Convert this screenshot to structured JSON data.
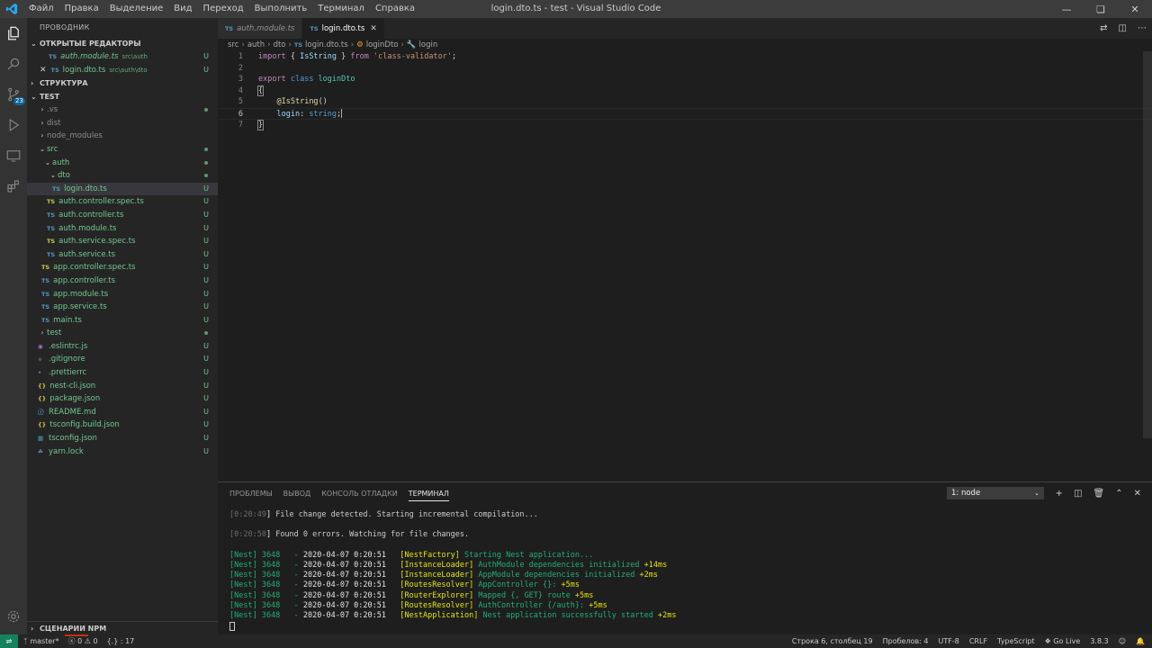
{
  "titlebar": {
    "menu": [
      "Файл",
      "Правка",
      "Выделение",
      "Вид",
      "Переход",
      "Выполнить",
      "Терминал",
      "Справка"
    ],
    "title": "login.dto.ts - test - Visual Studio Code"
  },
  "activity_bar": {
    "scm_badge": "23"
  },
  "sidebar": {
    "title": "ПРОВОДНИК",
    "open_editors_label": "ОТКРЫТЫЕ РЕДАКТОРЫ",
    "open_editors": [
      {
        "name": "auth.module.ts",
        "path": "src\\auth",
        "status": "U"
      },
      {
        "name": "login.dto.ts",
        "path": "src\\auth\\dto",
        "status": "U"
      }
    ],
    "outline_label": "СТРУКТУРА",
    "project_label": "TEST",
    "tree": [
      {
        "name": ".vs",
        "status": ""
      },
      {
        "name": "dist",
        "status": ""
      },
      {
        "name": "node_modules",
        "status": ""
      },
      {
        "name": "src",
        "status": ""
      },
      {
        "name": "auth",
        "status": ""
      },
      {
        "name": "dto",
        "status": ""
      },
      {
        "name": "login.dto.ts",
        "status": "U"
      },
      {
        "name": "auth.controller.spec.ts",
        "status": "U"
      },
      {
        "name": "auth.controller.ts",
        "status": "U"
      },
      {
        "name": "auth.module.ts",
        "status": "U"
      },
      {
        "name": "auth.service.spec.ts",
        "status": "U"
      },
      {
        "name": "auth.service.ts",
        "status": "U"
      },
      {
        "name": "app.controller.spec.ts",
        "status": "U"
      },
      {
        "name": "app.controller.ts",
        "status": "U"
      },
      {
        "name": "app.module.ts",
        "status": "U"
      },
      {
        "name": "app.service.ts",
        "status": "U"
      },
      {
        "name": "main.ts",
        "status": "U"
      },
      {
        "name": "test",
        "status": ""
      },
      {
        "name": ".eslintrc.js",
        "status": "U"
      },
      {
        "name": ".gitignore",
        "status": "U"
      },
      {
        "name": ".prettierrc",
        "status": "U"
      },
      {
        "name": "nest-cli.json",
        "status": "U"
      },
      {
        "name": "package.json",
        "status": "U"
      },
      {
        "name": "README.md",
        "status": "U"
      },
      {
        "name": "tsconfig.build.json",
        "status": "U"
      },
      {
        "name": "tsconfig.json",
        "status": "U"
      },
      {
        "name": "yarn.lock",
        "status": "U"
      }
    ],
    "npm_scripts_label": "СЦЕНАРИИ NPM"
  },
  "editor": {
    "tabs": [
      {
        "label": "auth.module.ts",
        "icon": "TS"
      },
      {
        "label": "login.dto.ts",
        "icon": "TS"
      }
    ],
    "breadcrumb": [
      "src",
      "auth",
      "dto",
      "login.dto.ts",
      "loginDto",
      "login"
    ],
    "line_numbers": [
      "1",
      "2",
      "3",
      "4",
      "5",
      "6",
      "7"
    ],
    "code": {
      "l1_import": "import",
      "l1_open": " { ",
      "l1_name": "IsString",
      "l1_close": " } ",
      "l1_from": "from",
      "l1_module": "'class-validator'",
      "l1_semi": ";",
      "l3_export": "export",
      "l3_class": "class",
      "l3_name": "loginDto",
      "l4_brace": "{",
      "l5_at": "@",
      "l5_dec": "IsString",
      "l5_paren": "()",
      "l6_prop": "login",
      "l6_colon": ": ",
      "l6_type": "string",
      "l6_semi": ";",
      "l7_brace": "}"
    }
  },
  "panel": {
    "tabs": [
      "ПРОБЛЕМЫ",
      "ВЫВОД",
      "КОНСОЛЬ ОТЛАДКИ",
      "ТЕРМИНАЛ"
    ],
    "terminal_select": "1: node",
    "terminal": {
      "l1_time": "0:20:49",
      "l1_msg": "File change detected. Starting incremental compilation...",
      "l2_time": "0:20:50",
      "l2_msg": "Found 0 errors. Watching for file changes.",
      "logs": [
        {
          "prefix": "[Nest] 3648   - ",
          "date": "2020-04-07 0:20:51",
          "ctx": "[NestFactory]",
          "msg": "Starting Nest application...",
          "delta": ""
        },
        {
          "prefix": "[Nest] 3648   - ",
          "date": "2020-04-07 0:20:51",
          "ctx": "[InstanceLoader]",
          "msg": "AuthModule dependencies initialized",
          "delta": "+14ms"
        },
        {
          "prefix": "[Nest] 3648   - ",
          "date": "2020-04-07 0:20:51",
          "ctx": "[InstanceLoader]",
          "msg": "AppModule dependencies initialized",
          "delta": "+2ms"
        },
        {
          "prefix": "[Nest] 3648   - ",
          "date": "2020-04-07 0:20:51",
          "ctx": "[RoutesResolver]",
          "msg": "AppController {}:",
          "delta": "+5ms"
        },
        {
          "prefix": "[Nest] 3648   - ",
          "date": "2020-04-07 0:20:51",
          "ctx": "[RouterExplorer]",
          "msg": "Mapped {, GET} route",
          "delta": "+5ms"
        },
        {
          "prefix": "[Nest] 3648   - ",
          "date": "2020-04-07 0:20:51",
          "ctx": "[RoutesResolver]",
          "msg": "AuthController {/auth}:",
          "delta": "+5ms"
        },
        {
          "prefix": "[Nest] 3648   - ",
          "date": "2020-04-07 0:20:51",
          "ctx": "[NestApplication]",
          "msg": "Nest application successfully started",
          "delta": "+2ms"
        }
      ]
    }
  },
  "statusbar": {
    "branch": "master*",
    "errors": "0",
    "warnings": "0",
    "extra": "{.} : 17",
    "position": "Строка 6, столбец 19",
    "spaces": "Пробелов: 4",
    "encoding": "UTF-8",
    "eol": "CRLF",
    "language": "TypeScript",
    "golive": "Go Live",
    "version": "3.8.3"
  },
  "colors": {
    "accent": "#007acc",
    "untracked": "#73c991",
    "remote": "#16825d"
  }
}
